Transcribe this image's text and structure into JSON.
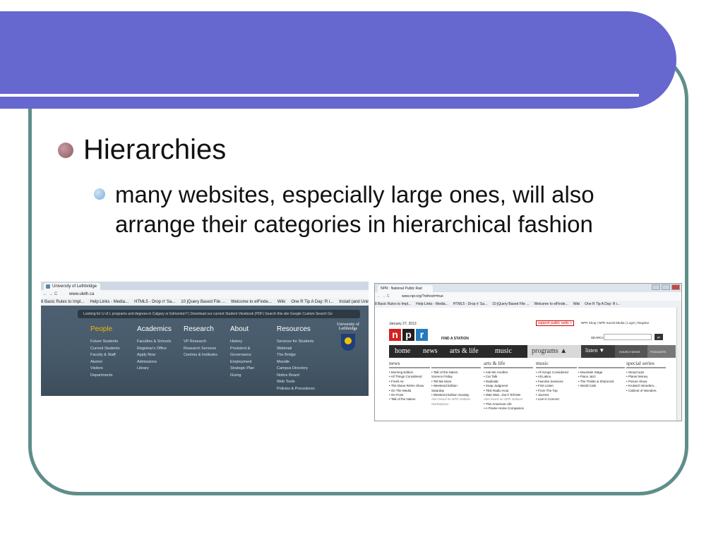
{
  "slide": {
    "bullet1": "Hierarchies",
    "bullet2": "many websites, especially large ones, will also arrange their categories in hierarchical fashion",
    "colors": {
      "banner": "#6667cf",
      "frame": "#5f8e8a",
      "bullet1": "#9c6a72",
      "bullet2": "#7aaedc"
    }
  },
  "shot1": {
    "tab_title": "University of Lethbridge",
    "url": "www.uleth.ca",
    "bookmarks": [
      "8 Basic Rules to Impl...",
      "Help:Links - Media...",
      "HTML5 - Drop n' Sa...",
      "10 jQuery Based File ...",
      "Welcome to elFinde...",
      "Wiki",
      "One R Tip A Day: R i...",
      "Install (and Uninstall..."
    ],
    "search_text": "Looking for U of L programs and degrees in Calgary or Edmonton? | Download our current Student Viewbook (PDF)     Search this site  Google Custom Search   Go",
    "logo": "University of Lethbridge",
    "columns": [
      {
        "head": "People",
        "items": [
          "Future Students",
          "Current Students",
          "Faculty & Staff",
          "Alumni",
          "Visitors",
          "Departments"
        ]
      },
      {
        "head": "Academics",
        "items": [
          "Faculties & Schools",
          "Registrar's Office",
          "Apply Now",
          "Admissions",
          "Library"
        ]
      },
      {
        "head": "Research",
        "items": [
          "VP Research",
          "Research Services",
          "Centres & Institutes"
        ]
      },
      {
        "head": "About",
        "items": [
          "History",
          "President &",
          "Governance",
          "Employment",
          "Strategic Plan",
          "Giving"
        ]
      },
      {
        "head": "Resources",
        "items": [
          "Services for Students",
          "Webmail",
          "The Bridge",
          "Moodle",
          "Campus Directory",
          "Notice Board",
          "Web Tools",
          "Policies & Procedures"
        ]
      }
    ]
  },
  "shot2": {
    "tab_title": "NPR : National Public Rad",
    "url": "www.npr.org/?refresh=true",
    "bookmarks": [
      "8 Basic Rules to Impl...",
      "Help:Links - Media...",
      "HTML5 - Drop n' Sa...",
      "10 jQuery Based File ...",
      "Welcome to elFinde...",
      "Wiki",
      "One R Tip A Day: R i..."
    ],
    "date": "January 27, 2013",
    "support": "support public radio >",
    "util": "NPR Shop  |  NPR Social Media  |  Login  |  Register",
    "logo": [
      "n",
      "p",
      "r"
    ],
    "logo_colors": [
      "#d62021",
      "#231f20",
      "#237bbd"
    ],
    "find": "FIND A STATION",
    "search_label": "SEARCH",
    "go": "go",
    "nav": [
      "home",
      "news",
      "arts & life",
      "music",
      "programs ▲",
      "listen ▼",
      "HOURLY NEWS",
      "PODCASTS"
    ],
    "sections": [
      {
        "head": "news",
        "items": [
          "• Morning Edition",
          "• All Things Considered",
          "• Fresh Air",
          "• The Diane Rehm Show",
          "• On The Media",
          "• On Point",
          "• Talk of the Nation"
        ]
      },
      {
        "head": "",
        "items": [
          "• Talk of the Nation",
          "  Science Friday",
          "• Tell Me More",
          "• Weekend Edition",
          "  Saturday",
          "• Weekend Edition Sunday",
          "Also heard on NPR stations",
          "Marketplace"
        ]
      },
      {
        "head": "arts & life",
        "items": [
          "• Ask Me Another",
          "• Car Talk",
          "• Radiolab",
          "• Snap Judgment",
          "• TED Radio Hour",
          "• Wait Wait...Don't Tell Me!",
          "Also heard on NPR stations",
          "• This American Life",
          "• A Prairie Home Companion"
        ]
      },
      {
        "head": "music",
        "items": [
          "• All Songs Considered",
          "• Alt.Latino",
          "• Favorite Sessions",
          "• First Listen",
          "• From The Top",
          "• Jazzset",
          "• Live in Concert"
        ]
      },
      {
        "head": "",
        "items": [
          "• Mountain Stage",
          "• Piano Jazz",
          "• The Thistle & Shamrock",
          "• World Cafe"
        ]
      },
      {
        "head": "special series",
        "items": [
          "• StoryCorps",
          "• Planet Money",
          "• Picture Show",
          "• Krulwich Wonders...",
          "• Cabinet of Wonders"
        ]
      }
    ]
  }
}
